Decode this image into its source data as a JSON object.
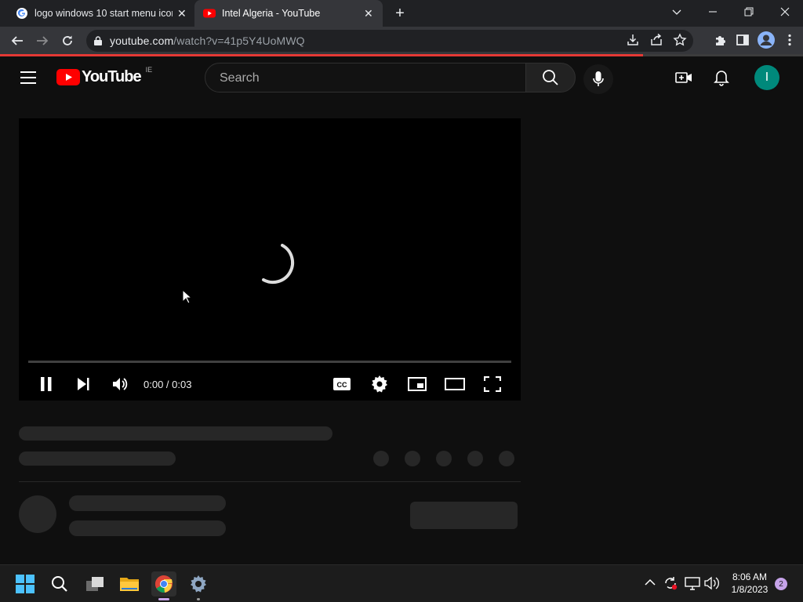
{
  "browser": {
    "tabs": [
      {
        "title": "logo windows 10 start menu icon",
        "favicon": "google-g-icon",
        "active": false
      },
      {
        "title": "Intel Algeria - YouTube",
        "favicon": "youtube-icon",
        "active": true
      }
    ],
    "url": {
      "host": "youtube.com",
      "path": "/watch?v=41p5Y4UoMWQ"
    }
  },
  "youtube": {
    "logo_text": "YouTube",
    "region": "IE",
    "search_placeholder": "Search",
    "avatar_letter": "I",
    "brand_color": "#ff0000",
    "avatar_color": "#00897b"
  },
  "player": {
    "time": "0:00 / 0:03",
    "state": "loading",
    "progress": 0
  },
  "taskbar": {
    "time": "8:06 AM",
    "date": "1/8/2023",
    "notification_count": "2"
  }
}
